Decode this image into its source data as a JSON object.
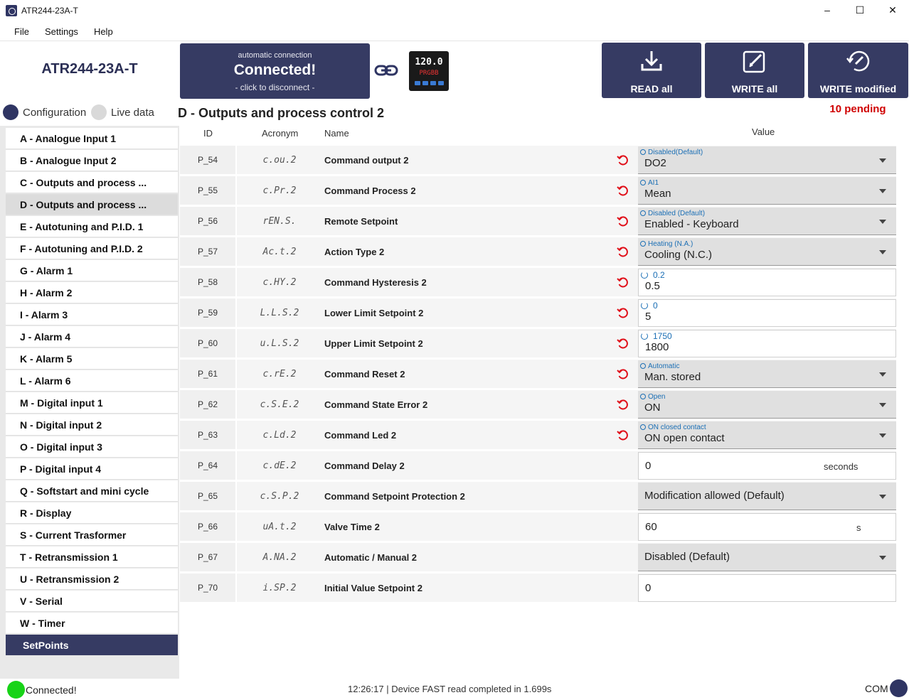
{
  "window": {
    "title": "ATR244-23A-T",
    "controls": [
      "–",
      "☐",
      "✕"
    ]
  },
  "menu": [
    "File",
    "Settings",
    "Help"
  ],
  "header": {
    "device_name": "ATR244-23A-T",
    "connection": {
      "mode": "automatic connection",
      "status": "Connected!",
      "hint": "- click to disconnect -"
    },
    "device_display": {
      "line1": "120.0",
      "line2": "PRGBB"
    },
    "buttons": {
      "read_all": "READ all",
      "write_all": "WRITE all",
      "write_modified": "WRITE modified"
    },
    "pending": "10 pending"
  },
  "modes": {
    "configuration": "Configuration",
    "live": "Live data"
  },
  "section_title": "D - Outputs and process control 2",
  "sidebar": [
    "A - Analogue Input 1",
    "B - Analogue Input 2",
    "C - Outputs and process ...",
    "D - Outputs and process ...",
    "E - Autotuning and P.I.D. 1",
    "F - Autotuning and P.I.D. 2",
    "G - Alarm 1",
    "H - Alarm 2",
    "I - Alarm 3",
    "J - Alarm 4",
    "K - Alarm 5",
    "L - Alarm 6",
    "M - Digital input 1",
    "N - Digital input 2",
    "O - Digital input 3",
    "P - Digital input 4",
    "Q - Softstart and mini cycle",
    "R - Display",
    "S - Current Trasformer",
    "T - Retransmission 1",
    "U - Retransmission 2",
    "V - Serial",
    "W - Timer",
    "SetPoints"
  ],
  "table": {
    "headers": {
      "id": "ID",
      "acronym": "Acronym",
      "name": "Name",
      "value": "Value"
    },
    "rows": [
      {
        "id": "P_54",
        "acronym": "c.ou.2",
        "name": "Command output 2",
        "modified": true,
        "type": "select",
        "default": "Disabled(Default)",
        "value": "DO2"
      },
      {
        "id": "P_55",
        "acronym": "c.Pr.2",
        "name": "Command Process 2",
        "modified": true,
        "type": "select",
        "default": "AI1",
        "value": "Mean"
      },
      {
        "id": "P_56",
        "acronym": "rEN.S.",
        "name": "Remote Setpoint",
        "modified": true,
        "type": "select",
        "default": "Disabled (Default)",
        "value": "Enabled - Keyboard"
      },
      {
        "id": "P_57",
        "acronym": "Ac.t.2",
        "name": "Action Type 2",
        "modified": true,
        "type": "select",
        "default": "Heating (N.A.)",
        "value": "Cooling (N.C.)"
      },
      {
        "id": "P_58",
        "acronym": "c.HY.2",
        "name": "Command Hysteresis 2",
        "modified": true,
        "type": "input",
        "default": "0.2",
        "value": "0.5"
      },
      {
        "id": "P_59",
        "acronym": "L.L.S.2",
        "name": "Lower Limit Setpoint 2",
        "modified": true,
        "type": "input",
        "default": "0",
        "value": "5"
      },
      {
        "id": "P_60",
        "acronym": "u.L.S.2",
        "name": "Upper Limit Setpoint 2",
        "modified": true,
        "type": "input",
        "default": "1750",
        "value": "1800"
      },
      {
        "id": "P_61",
        "acronym": "c.rE.2",
        "name": "Command Reset 2",
        "modified": true,
        "type": "select",
        "default": "Automatic",
        "value": "Man. stored"
      },
      {
        "id": "P_62",
        "acronym": "c.S.E.2",
        "name": "Command State Error 2",
        "modified": true,
        "type": "select",
        "default": "Open",
        "value": "ON"
      },
      {
        "id": "P_63",
        "acronym": "c.Ld.2",
        "name": "Command Led 2",
        "modified": true,
        "type": "select",
        "default": "ON closed contact",
        "value": "ON open contact"
      },
      {
        "id": "P_64",
        "acronym": "c.dE.2",
        "name": "Command Delay 2",
        "modified": false,
        "type": "input",
        "default": "",
        "value": "0",
        "unit": "seconds"
      },
      {
        "id": "P_65",
        "acronym": "c.S.P.2",
        "name": "Command Setpoint Protection 2",
        "modified": false,
        "type": "select",
        "default": "",
        "value": "Modification allowed (Default)"
      },
      {
        "id": "P_66",
        "acronym": "uA.t.2",
        "name": "Valve Time 2",
        "modified": false,
        "type": "input",
        "default": "",
        "value": "60",
        "unit": "s"
      },
      {
        "id": "P_67",
        "acronym": "A.NA.2",
        "name": "Automatic / Manual 2",
        "modified": false,
        "type": "select",
        "default": "",
        "value": "Disabled (Default)"
      },
      {
        "id": "P_70",
        "acronym": "i.SP.2",
        "name": "Initial Value Setpoint 2",
        "modified": false,
        "type": "input",
        "default": "",
        "value": "0"
      }
    ]
  },
  "status": {
    "connection": "Connected!",
    "message": "12:26:17 |   Device FAST read completed in 1.699s",
    "port": "COM"
  },
  "colors": {
    "primary": "#363b63",
    "modified": "#d00000",
    "default_hint": "#1b6fb5",
    "connected": "#17d317"
  }
}
